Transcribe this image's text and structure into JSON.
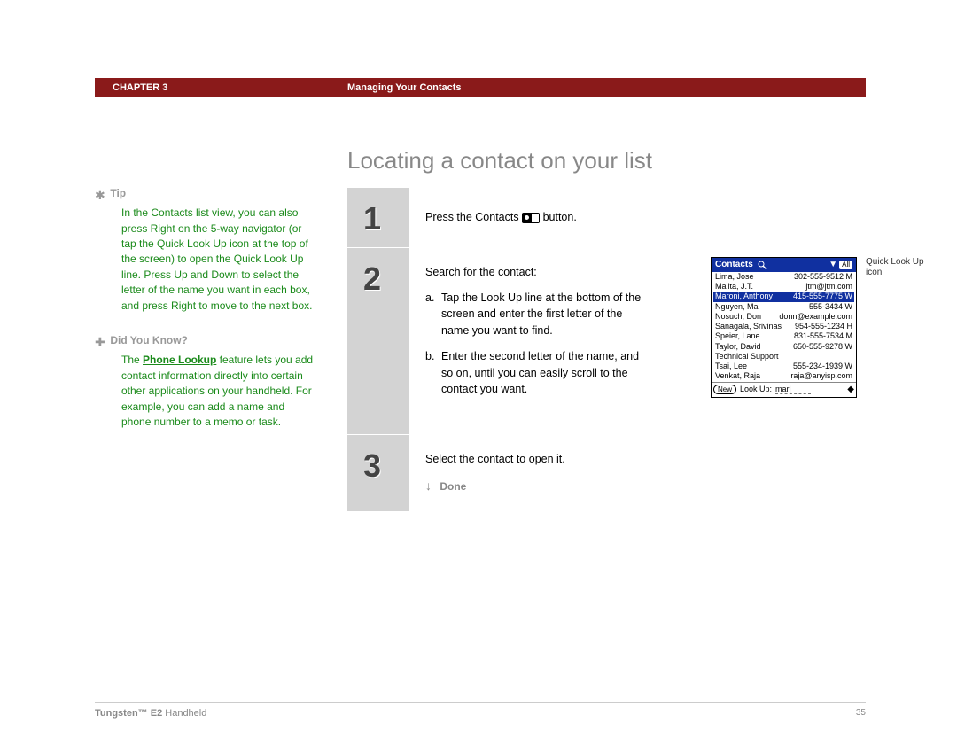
{
  "header": {
    "chapter": "CHAPTER 3",
    "title": "Managing Your Contacts"
  },
  "page_title": "Locating a contact on your list",
  "sidebar": {
    "tip": {
      "heading": "Tip",
      "body": "In the Contacts list view, you can also press Right on the 5-way navigator (or tap the Quick Look Up icon at the top of the screen) to open the Quick Look Up line. Press Up and Down to select the letter of the name you want in each box, and press Right to move to the next box."
    },
    "didyouknow": {
      "heading": "Did You Know?",
      "prefix": "The ",
      "link": "Phone Lookup",
      "suffix": " feature lets you add contact information directly into certain other applications on your handheld. For example, you can add a name and phone number to a memo or task."
    }
  },
  "steps": {
    "s1": {
      "num": "1",
      "text_before": "Press the Contacts ",
      "text_after": " button."
    },
    "s2": {
      "num": "2",
      "intro": "Search for the contact:",
      "a_letter": "a.",
      "a_text": "Tap the Look Up line at the bottom of the screen and enter the first letter of the name you want to find.",
      "b_letter": "b.",
      "b_text": "Enter the second letter of the name, and so on, until you can easily scroll to the contact you want."
    },
    "s3": {
      "num": "3",
      "text": "Select the contact to open it.",
      "done": "Done"
    }
  },
  "palm": {
    "title": "Contacts",
    "category": "All",
    "rows": [
      {
        "name": "Lima, Jose",
        "phone": "302-555-9512 M",
        "sel": false
      },
      {
        "name": "Malita, J.T.",
        "phone": "jtm@jtm.com",
        "sel": false
      },
      {
        "name": "Maroni, Anthony",
        "phone": "415-555-7775 W",
        "sel": true
      },
      {
        "name": "Nguyen, Mai",
        "phone": "555-3434 W",
        "sel": false
      },
      {
        "name": "Nosuch, Don",
        "phone": "donn@example.com",
        "sel": false
      },
      {
        "name": "Sanagala, Srivinas",
        "phone": "954-555-1234 H",
        "sel": false
      },
      {
        "name": "Speier, Lane",
        "phone": "831-555-7534 M",
        "sel": false
      },
      {
        "name": "Taylor, David",
        "phone": "650-555-9278 W",
        "sel": false
      },
      {
        "name": "Technical Support",
        "phone": "",
        "sel": false
      },
      {
        "name": "Tsai, Lee",
        "phone": "555-234-1939 W",
        "sel": false
      },
      {
        "name": "Venkat, Raja",
        "phone": "raja@anyisp.com",
        "sel": false
      }
    ],
    "new_btn": "New",
    "lookup_label": "Look Up:",
    "lookup_value": "mar"
  },
  "callout": "Quick Look Up icon",
  "footer": {
    "product_bold": "Tungsten™ E2",
    "product_rest": " Handheld",
    "page": "35"
  }
}
